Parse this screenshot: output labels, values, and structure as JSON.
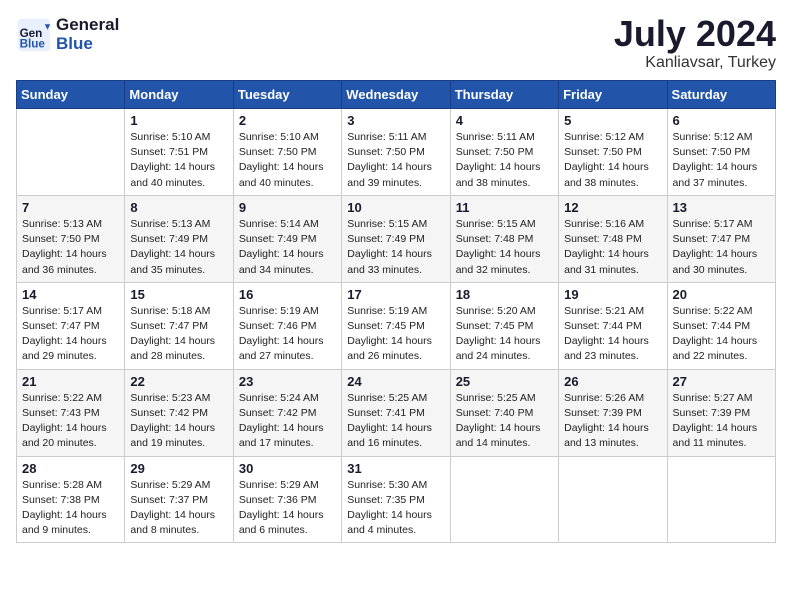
{
  "logo": {
    "general": "General",
    "blue": "Blue"
  },
  "title": "July 2024",
  "location": "Kanliavsar, Turkey",
  "days_header": [
    "Sunday",
    "Monday",
    "Tuesday",
    "Wednesday",
    "Thursday",
    "Friday",
    "Saturday"
  ],
  "weeks": [
    [
      {
        "day": "",
        "info": ""
      },
      {
        "day": "1",
        "info": "Sunrise: 5:10 AM\nSunset: 7:51 PM\nDaylight: 14 hours\nand 40 minutes."
      },
      {
        "day": "2",
        "info": "Sunrise: 5:10 AM\nSunset: 7:50 PM\nDaylight: 14 hours\nand 40 minutes."
      },
      {
        "day": "3",
        "info": "Sunrise: 5:11 AM\nSunset: 7:50 PM\nDaylight: 14 hours\nand 39 minutes."
      },
      {
        "day": "4",
        "info": "Sunrise: 5:11 AM\nSunset: 7:50 PM\nDaylight: 14 hours\nand 38 minutes."
      },
      {
        "day": "5",
        "info": "Sunrise: 5:12 AM\nSunset: 7:50 PM\nDaylight: 14 hours\nand 38 minutes."
      },
      {
        "day": "6",
        "info": "Sunrise: 5:12 AM\nSunset: 7:50 PM\nDaylight: 14 hours\nand 37 minutes."
      }
    ],
    [
      {
        "day": "7",
        "info": "Sunrise: 5:13 AM\nSunset: 7:50 PM\nDaylight: 14 hours\nand 36 minutes."
      },
      {
        "day": "8",
        "info": "Sunrise: 5:13 AM\nSunset: 7:49 PM\nDaylight: 14 hours\nand 35 minutes."
      },
      {
        "day": "9",
        "info": "Sunrise: 5:14 AM\nSunset: 7:49 PM\nDaylight: 14 hours\nand 34 minutes."
      },
      {
        "day": "10",
        "info": "Sunrise: 5:15 AM\nSunset: 7:49 PM\nDaylight: 14 hours\nand 33 minutes."
      },
      {
        "day": "11",
        "info": "Sunrise: 5:15 AM\nSunset: 7:48 PM\nDaylight: 14 hours\nand 32 minutes."
      },
      {
        "day": "12",
        "info": "Sunrise: 5:16 AM\nSunset: 7:48 PM\nDaylight: 14 hours\nand 31 minutes."
      },
      {
        "day": "13",
        "info": "Sunrise: 5:17 AM\nSunset: 7:47 PM\nDaylight: 14 hours\nand 30 minutes."
      }
    ],
    [
      {
        "day": "14",
        "info": "Sunrise: 5:17 AM\nSunset: 7:47 PM\nDaylight: 14 hours\nand 29 minutes."
      },
      {
        "day": "15",
        "info": "Sunrise: 5:18 AM\nSunset: 7:47 PM\nDaylight: 14 hours\nand 28 minutes."
      },
      {
        "day": "16",
        "info": "Sunrise: 5:19 AM\nSunset: 7:46 PM\nDaylight: 14 hours\nand 27 minutes."
      },
      {
        "day": "17",
        "info": "Sunrise: 5:19 AM\nSunset: 7:45 PM\nDaylight: 14 hours\nand 26 minutes."
      },
      {
        "day": "18",
        "info": "Sunrise: 5:20 AM\nSunset: 7:45 PM\nDaylight: 14 hours\nand 24 minutes."
      },
      {
        "day": "19",
        "info": "Sunrise: 5:21 AM\nSunset: 7:44 PM\nDaylight: 14 hours\nand 23 minutes."
      },
      {
        "day": "20",
        "info": "Sunrise: 5:22 AM\nSunset: 7:44 PM\nDaylight: 14 hours\nand 22 minutes."
      }
    ],
    [
      {
        "day": "21",
        "info": "Sunrise: 5:22 AM\nSunset: 7:43 PM\nDaylight: 14 hours\nand 20 minutes."
      },
      {
        "day": "22",
        "info": "Sunrise: 5:23 AM\nSunset: 7:42 PM\nDaylight: 14 hours\nand 19 minutes."
      },
      {
        "day": "23",
        "info": "Sunrise: 5:24 AM\nSunset: 7:42 PM\nDaylight: 14 hours\nand 17 minutes."
      },
      {
        "day": "24",
        "info": "Sunrise: 5:25 AM\nSunset: 7:41 PM\nDaylight: 14 hours\nand 16 minutes."
      },
      {
        "day": "25",
        "info": "Sunrise: 5:25 AM\nSunset: 7:40 PM\nDaylight: 14 hours\nand 14 minutes."
      },
      {
        "day": "26",
        "info": "Sunrise: 5:26 AM\nSunset: 7:39 PM\nDaylight: 14 hours\nand 13 minutes."
      },
      {
        "day": "27",
        "info": "Sunrise: 5:27 AM\nSunset: 7:39 PM\nDaylight: 14 hours\nand 11 minutes."
      }
    ],
    [
      {
        "day": "28",
        "info": "Sunrise: 5:28 AM\nSunset: 7:38 PM\nDaylight: 14 hours\nand 9 minutes."
      },
      {
        "day": "29",
        "info": "Sunrise: 5:29 AM\nSunset: 7:37 PM\nDaylight: 14 hours\nand 8 minutes."
      },
      {
        "day": "30",
        "info": "Sunrise: 5:29 AM\nSunset: 7:36 PM\nDaylight: 14 hours\nand 6 minutes."
      },
      {
        "day": "31",
        "info": "Sunrise: 5:30 AM\nSunset: 7:35 PM\nDaylight: 14 hours\nand 4 minutes."
      },
      {
        "day": "",
        "info": ""
      },
      {
        "day": "",
        "info": ""
      },
      {
        "day": "",
        "info": ""
      }
    ]
  ]
}
